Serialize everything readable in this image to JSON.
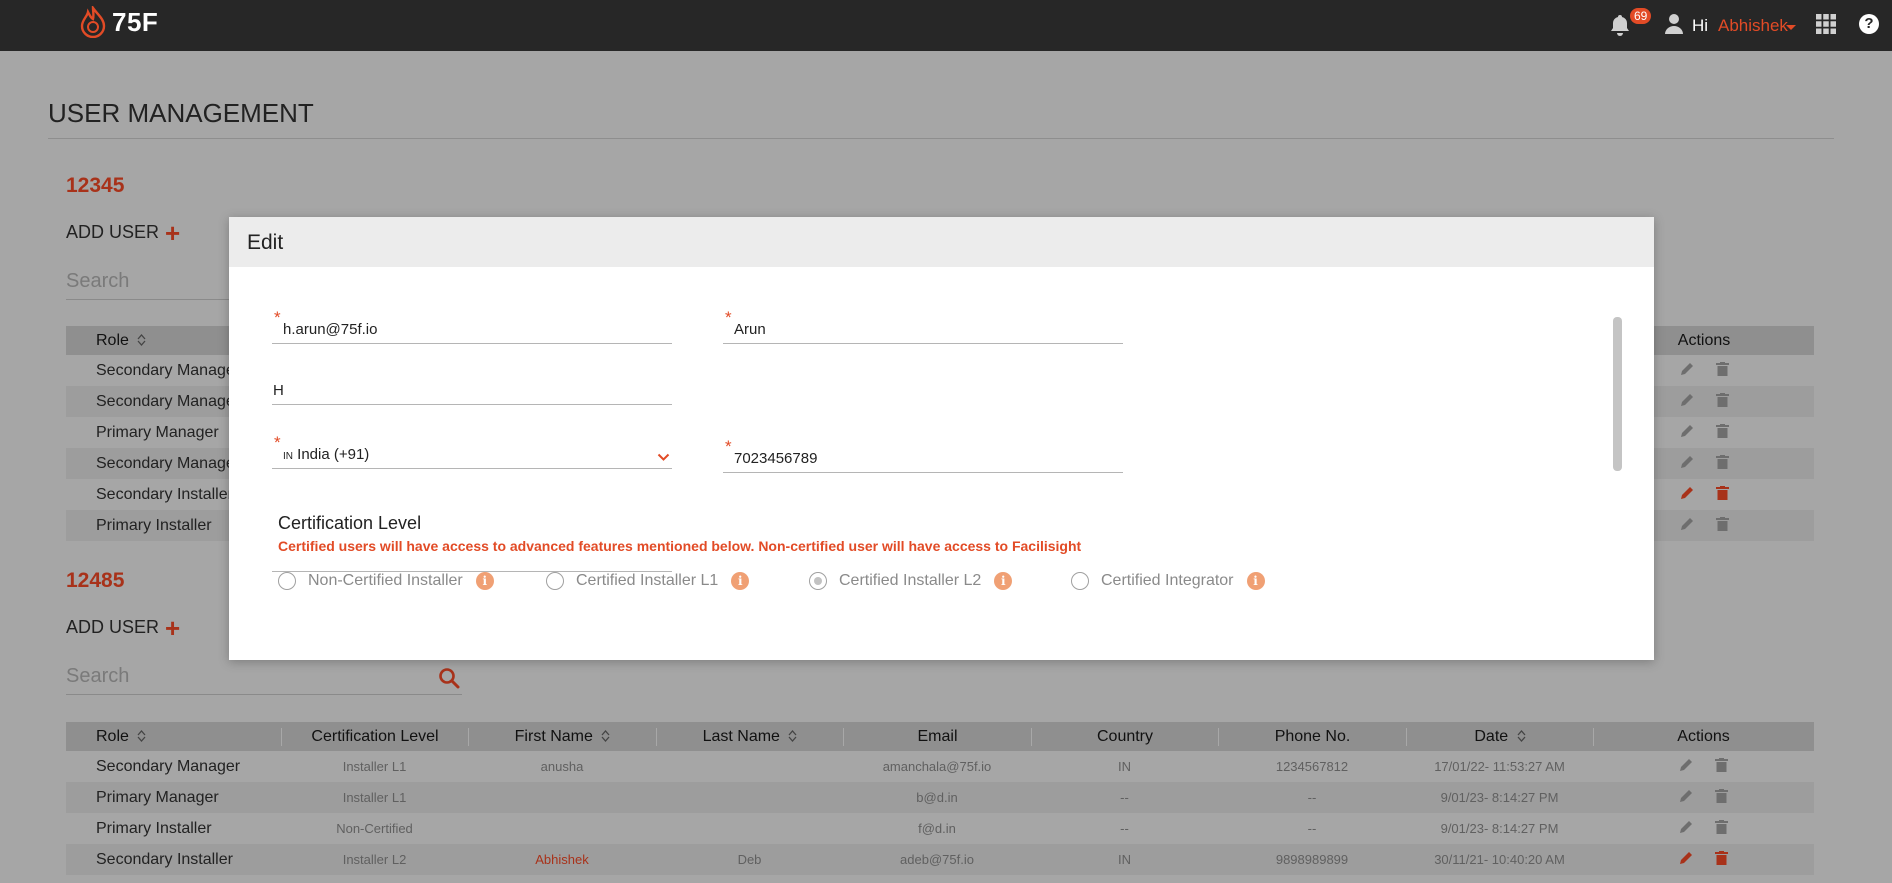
{
  "header": {
    "brand": "75F",
    "notification_count": "69",
    "greeting": "Hi",
    "username": "Abhishek",
    "help": "?"
  },
  "page": {
    "title": "USER MANAGEMENT",
    "sites": [
      {
        "id": "12345",
        "add_user_label": "ADD USER",
        "search_placeholder": "Search",
        "columns": [
          "Role",
          "Actions"
        ],
        "rows": [
          {
            "role": "Secondary Manager"
          },
          {
            "role": "Secondary Manager"
          },
          {
            "role": "Primary Manager"
          },
          {
            "role": "Secondary Manager"
          },
          {
            "role": "Secondary Installer"
          },
          {
            "role": "Primary Installer"
          }
        ]
      },
      {
        "id": "12485",
        "add_user_label": "ADD USER",
        "search_placeholder": "Search",
        "columns": [
          "Role",
          "Certification Level",
          "First Name",
          "Last Name",
          "Email",
          "Country",
          "Phone No.",
          "Date",
          "Actions"
        ],
        "rows": [
          {
            "role": "Secondary Manager",
            "cert": "Installer L1",
            "first": "anusha",
            "last": "",
            "email": "amanchala@75f.io",
            "country": "IN",
            "phone": "1234567812",
            "date": "17/01/22- 11:53:27 AM"
          },
          {
            "role": "Primary Manager",
            "cert": "Installer L1",
            "first": "",
            "last": "",
            "email": "b@d.in",
            "country": "--",
            "phone": "--",
            "date": "9/01/23- 8:14:27 PM"
          },
          {
            "role": "Primary Installer",
            "cert": "Non-Certified",
            "first": "",
            "last": "",
            "email": "f@d.in",
            "country": "--",
            "phone": "--",
            "date": "9/01/23- 8:14:27 PM"
          },
          {
            "role": "Secondary Installer",
            "cert": "Installer L2",
            "first": "Abhishek",
            "last": "Deb",
            "email": "adeb@75f.io",
            "country": "IN",
            "phone": "9898989899",
            "date": "30/11/21- 10:40:20 AM"
          }
        ]
      }
    ]
  },
  "modal": {
    "title": "Edit",
    "email": "h.arun@75f.io",
    "first_name": "Arun",
    "last_name": "H",
    "country_code_flag": "IN",
    "country": "India (+91)",
    "phone": "7023456789",
    "cert_title": "Certification Level",
    "cert_note": "Certified users will have access to advanced features mentioned below. Non-certified user will have access to Facilisight",
    "cert_options": [
      {
        "label": "Non-Certified Installer",
        "selected": false
      },
      {
        "label": "Certified Installer L1",
        "selected": false
      },
      {
        "label": "Certified Installer L2",
        "selected": true
      },
      {
        "label": "Certified Integrator",
        "selected": false
      }
    ]
  },
  "colors": {
    "accent": "#e24b26",
    "accent_dark": "#a8321a",
    "topbar": "#272727"
  },
  "icons": [
    "logo-flame-icon",
    "bell-icon",
    "user-icon",
    "apps-grid-icon",
    "help-icon",
    "plus-icon",
    "search-icon",
    "sort-icon",
    "edit-icon",
    "delete-icon",
    "chevron-down-icon",
    "info-icon"
  ]
}
